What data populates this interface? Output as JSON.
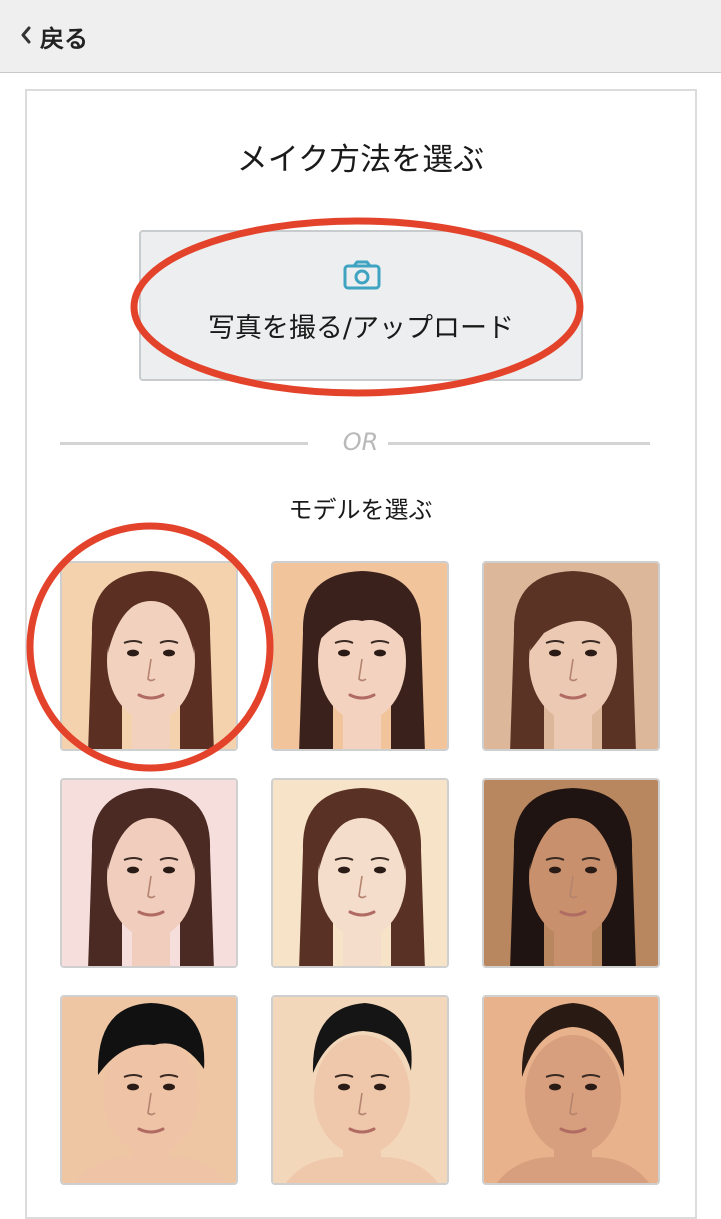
{
  "topbar": {
    "back_label": "戻る"
  },
  "main": {
    "title": "メイク方法を選ぶ",
    "upload_label": "写真を撮る/アップロード",
    "divider_text": "OR",
    "models_title": "モデルを選ぶ"
  },
  "models": [
    {
      "id": "model-1",
      "gender": "female",
      "bg": "#f4d2ae",
      "skin": "#f2d2bf",
      "hair": "#5b2f22",
      "style": "long-center"
    },
    {
      "id": "model-2",
      "gender": "female",
      "bg": "#f1c49c",
      "skin": "#f3d3c0",
      "hair": "#3a211b",
      "style": "bob-bangs"
    },
    {
      "id": "model-3",
      "gender": "female",
      "bg": "#ddb79a",
      "skin": "#ecc9b2",
      "hair": "#5a3325",
      "style": "long-side"
    },
    {
      "id": "model-4",
      "gender": "female",
      "bg": "#f6dedd",
      "skin": "#f0cdbd",
      "hair": "#4a2a22",
      "style": "long-center"
    },
    {
      "id": "model-5",
      "gender": "female",
      "bg": "#f7e3c8",
      "skin": "#f4ddcb",
      "hair": "#5a3125",
      "style": "long-center"
    },
    {
      "id": "model-6",
      "gender": "female",
      "bg": "#b9875f",
      "skin": "#c8906c",
      "hair": "#1f1411",
      "style": "long-center"
    },
    {
      "id": "model-7",
      "gender": "male",
      "bg": "#efc6a3",
      "skin": "#eec3a6",
      "hair": "#111111",
      "style": "short-fringe"
    },
    {
      "id": "model-8",
      "gender": "male",
      "bg": "#f3d7ba",
      "skin": "#efc7aa",
      "hair": "#151515",
      "style": "short-up"
    },
    {
      "id": "model-9",
      "gender": "male",
      "bg": "#e8b28c",
      "skin": "#d79f7d",
      "hair": "#2a1a14",
      "style": "short-center"
    }
  ],
  "colors": {
    "annotation": "#e4432b",
    "camera_icon": "#3fa3c2",
    "topbar_bg": "#efeff0"
  }
}
